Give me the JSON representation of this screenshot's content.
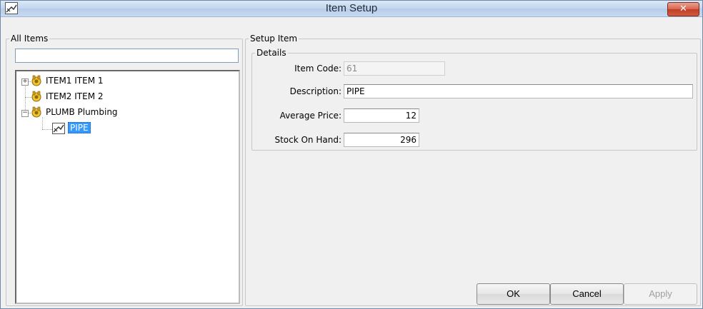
{
  "window": {
    "title": "Item Setup",
    "close_glyph": "✕"
  },
  "left_panel": {
    "legend": "All Items",
    "filter_value": "",
    "tree": [
      {
        "label": "ITEM1 ITEM 1",
        "expander": "+",
        "icon": "item-group-icon"
      },
      {
        "label": "ITEM2 ITEM 2",
        "expander": "",
        "icon": "item-group-icon"
      },
      {
        "label": "PLUMB Plumbing",
        "expander": "−",
        "icon": "item-group-icon"
      },
      {
        "label": "PIPE",
        "icon": "pipe-item-icon",
        "selected": true
      }
    ]
  },
  "setup": {
    "legend": "Setup Item",
    "details_legend": "Details",
    "item_code_label": "Item Code:",
    "item_code": "61",
    "description_label": "Description:",
    "description": "PIPE",
    "avg_price_label": "Average Price:",
    "avg_price": "12",
    "stock_label": "Stock On Hand:",
    "stock": "296"
  },
  "buttons": {
    "ok": "OK",
    "cancel": "Cancel",
    "apply": "Apply"
  }
}
